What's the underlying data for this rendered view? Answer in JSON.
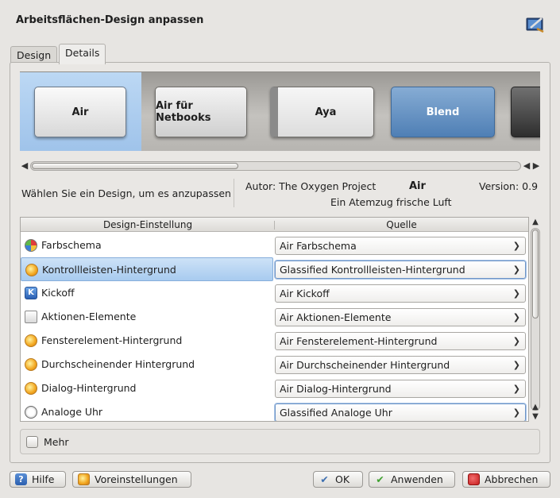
{
  "window": {
    "title": "Arbeitsflächen-Design anpassen",
    "icon": "desktop-theme-icon"
  },
  "tabs": [
    {
      "label": "Design",
      "active": false
    },
    {
      "label": "Details",
      "active": true
    }
  ],
  "themes": [
    {
      "label": "Air",
      "selected": true
    },
    {
      "label": "Air für Netbooks",
      "selected": false
    },
    {
      "label": "Aya",
      "selected": false
    },
    {
      "label": "Blend",
      "selected": false
    },
    {
      "label": "",
      "selected": false
    }
  ],
  "info": {
    "hint": "Wählen Sie ein Design, um es anzupassen",
    "author": "Autor: The Oxygen Project",
    "theme_name": "Air",
    "version": "Version: 0.9",
    "description": "Ein Atemzug frische Luft"
  },
  "table": {
    "headers": {
      "setting": "Design-Einstellung",
      "source": "Quelle"
    },
    "rows": [
      {
        "label": "Farbschema",
        "source": "Air Farbschema",
        "icon": "color-scheme-icon",
        "selected": false
      },
      {
        "label": "Kontrollleisten-Hintergrund",
        "source": "Glassified Kontrollleisten-Hintergrund",
        "icon": "plasma-theme-icon",
        "selected": true
      },
      {
        "label": "Kickoff",
        "source": "Air Kickoff",
        "icon": "kickoff-icon",
        "selected": false
      },
      {
        "label": "Aktionen-Elemente",
        "source": "Air Aktionen-Elemente",
        "icon": "window-icon",
        "selected": false
      },
      {
        "label": "Fensterelement-Hintergrund",
        "source": "Air Fensterelement-Hintergrund",
        "icon": "plasma-theme-icon",
        "selected": false
      },
      {
        "label": "Durchscheinender Hintergrund",
        "source": "Air Durchscheinender Hintergrund",
        "icon": "plasma-theme-icon",
        "selected": false
      },
      {
        "label": "Dialog-Hintergrund",
        "source": "Air Dialog-Hintergrund",
        "icon": "plasma-theme-icon",
        "selected": false
      },
      {
        "label": "Analoge Uhr",
        "source": "Glassified Analoge Uhr",
        "icon": "clock-icon",
        "selected": false
      }
    ]
  },
  "more": {
    "label": "Mehr",
    "checked": false
  },
  "buttons": {
    "help": "Hilfe",
    "defaults": "Voreinstellungen",
    "ok": "OK",
    "apply": "Anwenden",
    "cancel": "Abbrechen"
  },
  "colors": {
    "selection": "#a9cbee",
    "background": "#e7e5e2",
    "blend_theme": "#5f8fc2"
  }
}
